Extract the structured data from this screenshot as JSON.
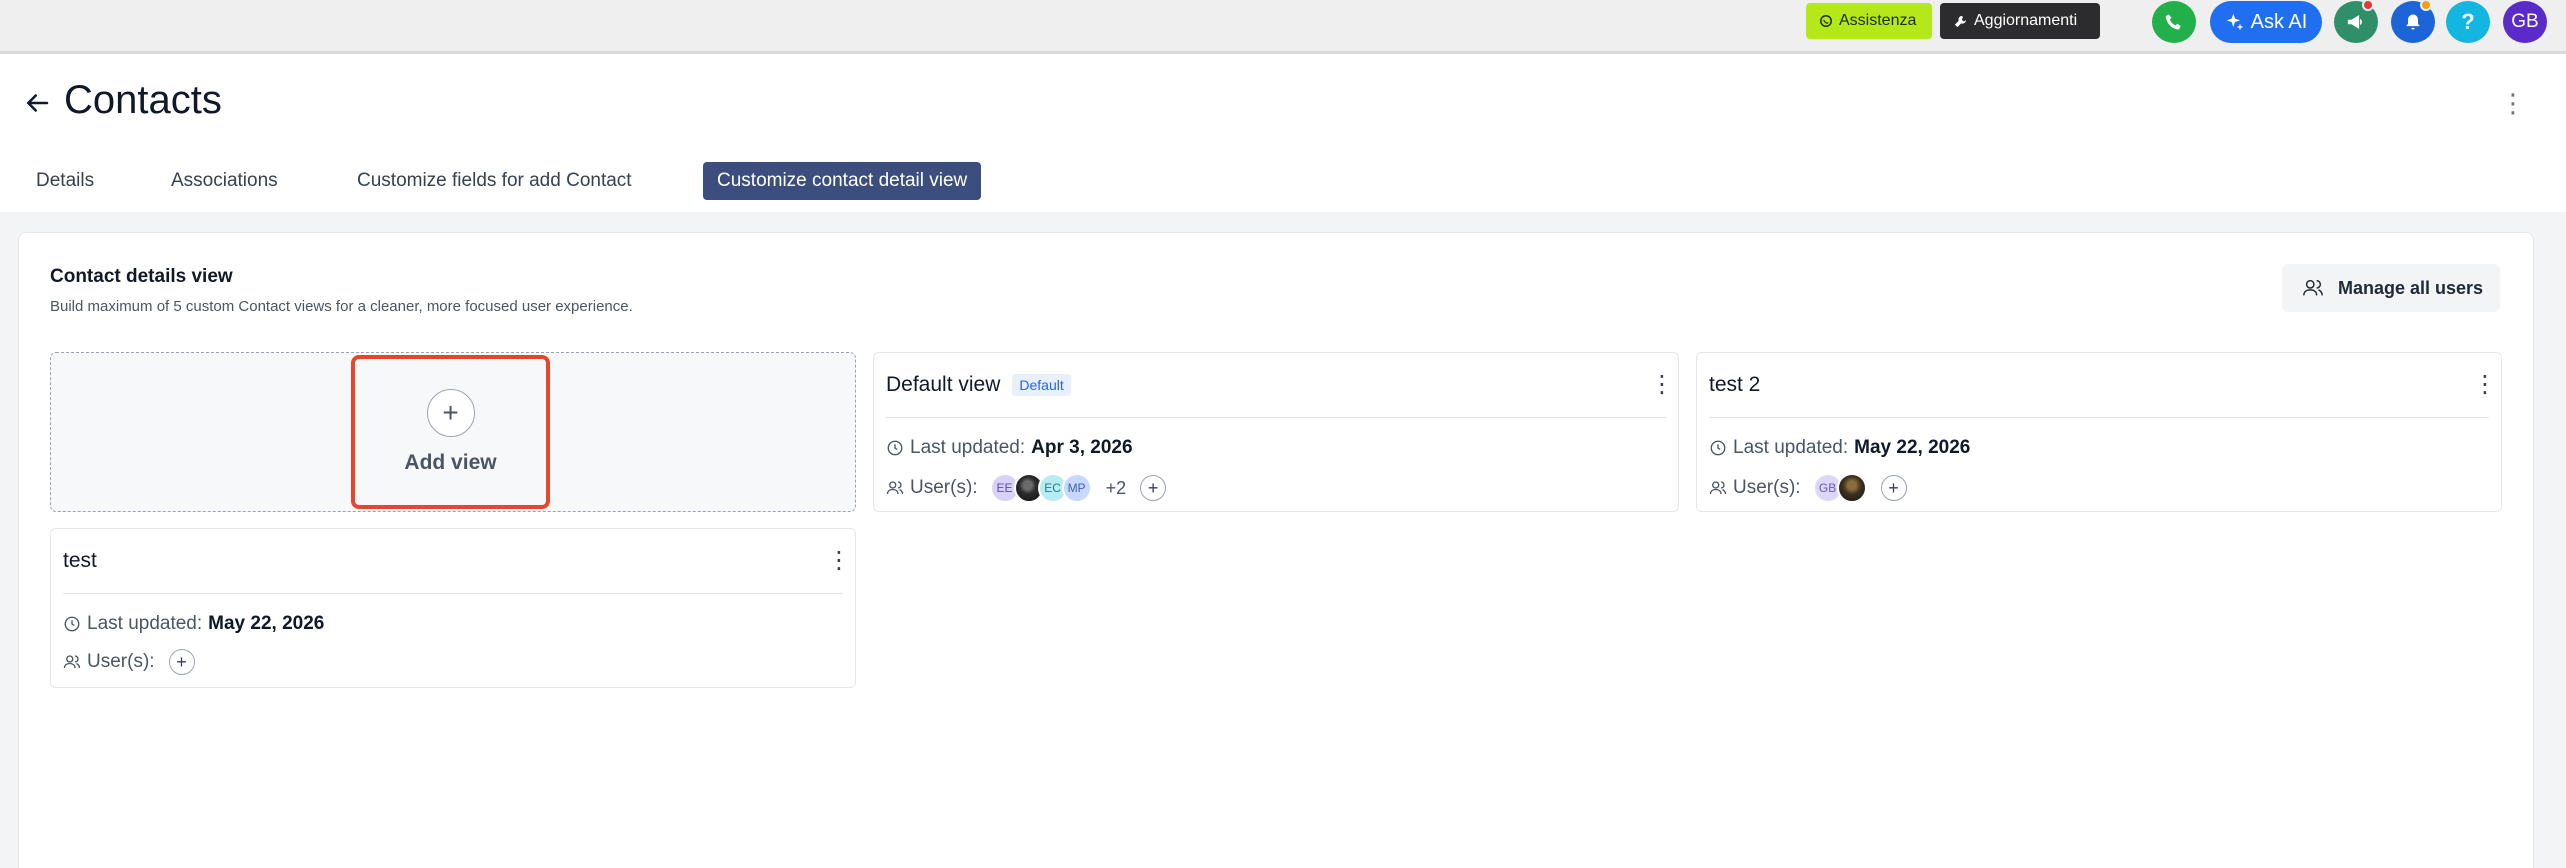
{
  "topbar": {
    "assistenza_label": "Assistenza",
    "aggiornamenti_label": "Aggiornamenti",
    "ask_ai_label": "Ask AI",
    "help_label": "?",
    "avatar_initials": "GB"
  },
  "header": {
    "title": "Contacts"
  },
  "tabs": [
    {
      "label": "Details"
    },
    {
      "label": "Associations"
    },
    {
      "label": "Customize fields for add Contact"
    },
    {
      "label": "Customize contact detail view",
      "active": true
    }
  ],
  "section": {
    "title": "Contact details view",
    "subtitle": "Build maximum of 5 custom Contact views for a cleaner, more focused user experience.",
    "manage_users_label": "Manage all users"
  },
  "add_view": {
    "label": "Add view"
  },
  "meta_labels": {
    "last_updated": "Last updated:",
    "users": "User(s):"
  },
  "views": [
    {
      "name": "Default view",
      "badge": "Default",
      "last_updated": "Apr 3, 2026",
      "avatars": [
        "EE",
        "",
        "EC",
        "MP"
      ],
      "more_count": "+2"
    },
    {
      "name": "test 2",
      "last_updated": "May 22, 2026",
      "avatars": [
        "GB",
        ""
      ]
    },
    {
      "name": "test",
      "last_updated": "May 22, 2026",
      "avatars": []
    }
  ],
  "colors": {
    "accent": "#3b4e7d",
    "highlight": "#e8452c",
    "assist": "#b5e81b",
    "ask_ai": "#1f6ff0"
  }
}
